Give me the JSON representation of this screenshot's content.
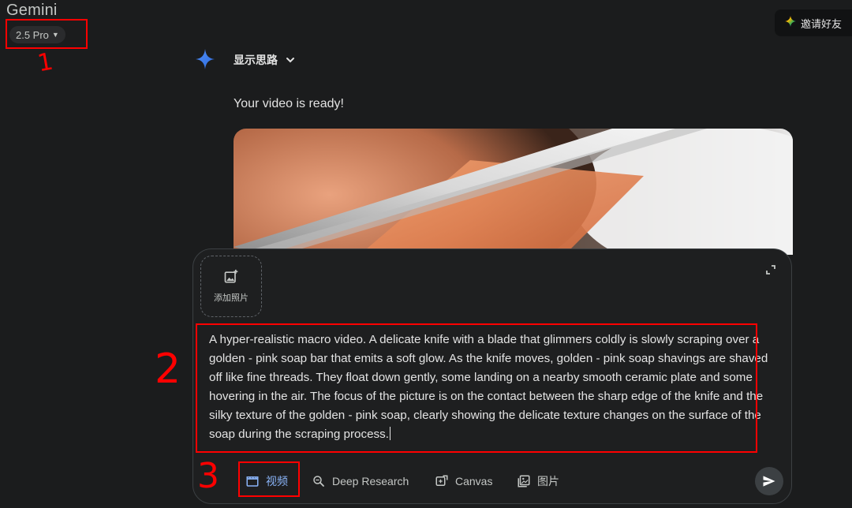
{
  "header": {
    "app_title": "Gemini",
    "model_label": "2.5 Pro",
    "invite_label": "邀请好友"
  },
  "response": {
    "thoughts_label": "显示思路",
    "text": "Your video is ready!"
  },
  "composer": {
    "add_photo_label": "添加照片",
    "prompt": "A hyper-realistic macro video. A delicate knife with a blade that glimmers coldly is slowly scraping over a golden - pink soap bar that emits a soft glow. As the knife moves, golden - pink soap shavings are shaved off like fine threads. They float down gently, some landing on a nearby smooth ceramic plate and some hovering in the air. The focus of the picture is on the contact between the sharp edge of the knife and the silky texture of the golden - pink soap, clearly showing the delicate texture changes on the surface of the soap during the scraping process.",
    "tools": [
      {
        "label": "视频",
        "icon": "video-clapper-icon",
        "active": true
      },
      {
        "label": "Deep Research",
        "icon": "deep-research-icon",
        "active": false
      },
      {
        "label": "Canvas",
        "icon": "canvas-icon",
        "active": false
      },
      {
        "label": "图片",
        "icon": "image-gallery-icon",
        "active": false
      }
    ]
  },
  "annotations": {
    "labels": [
      "1",
      "2",
      "3"
    ],
    "color": "#ff0000"
  },
  "colors": {
    "background": "#1b1c1d",
    "accent": "#8ab4f8",
    "annotation": "#ff0000"
  }
}
